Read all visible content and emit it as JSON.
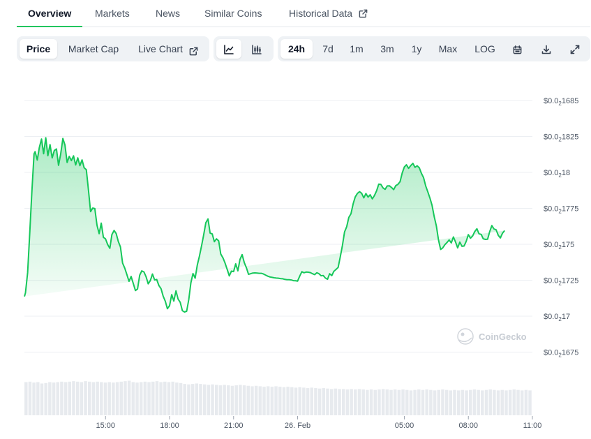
{
  "tabs": [
    {
      "label": "Overview"
    },
    {
      "label": "Markets"
    },
    {
      "label": "News"
    },
    {
      "label": "Similar Coins"
    },
    {
      "label": "Historical Data"
    }
  ],
  "toolbar": {
    "view_buttons": [
      {
        "label": "Price",
        "selected": true
      },
      {
        "label": "Market Cap",
        "selected": false
      },
      {
        "label": "Live Chart",
        "selected": false
      }
    ],
    "chart_type_buttons": [
      {
        "icon": "line-chart-icon",
        "selected": true
      },
      {
        "icon": "candlestick-chart-icon",
        "selected": false
      }
    ],
    "range_buttons": [
      {
        "label": "24h",
        "selected": true
      },
      {
        "label": "7d",
        "selected": false
      },
      {
        "label": "1m",
        "selected": false
      },
      {
        "label": "3m",
        "selected": false
      },
      {
        "label": "1y",
        "selected": false
      },
      {
        "label": "Max",
        "selected": false
      },
      {
        "label": "LOG",
        "selected": false
      }
    ],
    "action_icons": [
      "calendar-icon",
      "download-icon",
      "fullscreen-icon"
    ]
  },
  "watermark": "CoinGecko",
  "colors": {
    "line": "#16c75a",
    "accent": "#22c55e"
  },
  "chart_data": {
    "type": "area",
    "price_prefix": "$0.0",
    "price_subscript": "2",
    "y_ticks": [
      {
        "value": 0.001685,
        "digits": "1685"
      },
      {
        "value": 0.0018225,
        "digits": "1825"
      },
      {
        "value": 0.00218,
        "digits": "18"
      },
      {
        "value": 0.001775,
        "digits": "1775"
      },
      {
        "value": 0.00175,
        "digits": "175"
      },
      {
        "value": 0.001725,
        "digits": "1725"
      },
      {
        "value": 0.0017,
        "digits": "17"
      },
      {
        "value": 0.001675,
        "digits": "1675"
      }
    ],
    "y_tick_plain": [
      0.001685,
      0.0018225,
      0.0018,
      0.001775,
      0.00175,
      0.001725,
      0.0017,
      0.001675
    ],
    "ylim": [
      0.001675,
      0.001685
    ],
    "x_ticks": [
      "15:00",
      "18:00",
      "21:00",
      "26. Feb",
      "05:00",
      "08:00",
      "11:00"
    ],
    "x_tick_hours": [
      15,
      18,
      21,
      24,
      29,
      32,
      35
    ],
    "x_range_hours": [
      11.2,
      35.0
    ],
    "series": [
      {
        "x_hours": [
          11.2,
          11.25,
          11.35,
          11.45,
          11.55,
          11.65,
          11.7,
          11.8,
          11.9,
          12.0,
          12.1,
          12.2,
          12.3,
          12.4,
          12.5,
          12.6,
          12.7,
          12.8,
          12.9,
          13.0,
          13.1,
          13.2,
          13.3,
          13.4,
          13.5,
          13.6,
          13.7,
          13.8,
          13.9,
          14.0,
          14.1,
          14.2,
          14.3,
          14.4,
          14.5,
          14.6,
          14.7,
          14.8,
          14.9,
          15.0,
          15.1,
          15.2,
          15.3,
          15.4,
          15.5,
          15.6,
          15.7,
          15.8,
          15.9,
          16.0,
          16.1,
          16.2,
          16.3,
          16.4,
          16.5,
          16.6,
          16.7,
          16.8,
          16.9,
          17.0,
          17.1,
          17.2,
          17.3,
          17.4,
          17.5,
          17.6,
          17.7,
          17.8,
          17.9,
          18.0,
          18.1,
          18.2,
          18.3,
          18.4,
          18.5,
          18.6,
          18.7,
          18.8,
          18.9,
          19.0,
          19.1,
          19.2,
          19.3,
          19.4,
          19.5,
          19.6,
          19.7,
          19.8,
          19.9,
          20.0,
          20.1,
          20.2,
          20.3,
          20.4,
          20.5,
          20.6,
          20.7,
          20.8,
          20.9,
          21.0,
          21.1,
          21.2,
          21.3,
          21.4,
          21.5,
          21.6,
          21.7,
          21.8,
          21.9,
          22.0,
          22.1,
          22.2,
          22.3,
          22.4,
          22.5,
          22.6,
          22.7,
          22.8,
          22.9,
          23.0,
          23.1,
          23.2,
          23.3,
          23.4,
          23.5,
          23.6,
          23.7,
          23.8,
          23.9,
          24.0,
          24.1,
          24.2,
          24.3,
          24.4,
          24.5,
          24.6,
          24.7,
          24.8,
          24.9,
          25.0,
          25.1,
          25.2,
          25.3,
          25.4,
          25.5,
          25.6,
          25.7,
          25.8,
          25.9,
          26.0,
          26.1,
          26.2,
          26.3,
          26.4,
          26.5,
          26.6,
          26.7,
          26.8,
          26.9,
          27.0,
          27.1,
          27.2,
          27.3,
          27.4,
          27.5,
          27.6,
          27.7,
          27.8,
          27.9,
          28.0,
          28.1,
          28.2,
          28.3,
          28.4,
          28.5,
          28.6,
          28.7,
          28.8,
          28.9,
          29.0,
          29.1,
          29.2,
          29.3,
          29.4,
          29.5,
          29.6,
          29.7,
          29.8,
          29.9,
          30.0,
          30.1,
          30.2,
          30.3,
          30.4,
          30.5,
          30.6,
          30.7,
          30.8,
          30.9,
          31.0,
          31.1,
          31.2,
          31.3,
          31.4,
          31.5,
          31.6,
          31.7,
          31.8,
          31.9,
          32.0,
          32.1,
          32.2,
          32.3,
          32.4,
          32.5,
          32.6,
          32.7,
          32.8,
          32.9,
          33.0,
          33.1,
          33.2,
          33.3,
          33.4,
          33.5,
          33.6,
          33.7,
          33.8,
          33.9,
          34.0,
          34.1,
          34.2,
          34.3,
          34.4,
          34.5,
          34.6,
          34.7,
          34.8,
          34.9,
          35.0
        ],
        "prices": [
          0.0017137,
          0.0017162,
          0.0017303,
          0.0017575,
          0.0017868,
          0.0018129,
          0.0018144,
          0.0018086,
          0.0018174,
          0.0018232,
          0.001813,
          0.0018241,
          0.0018116,
          0.0018193,
          0.0018101,
          0.0018152,
          0.0018163,
          0.0018049,
          0.0018129,
          0.0018236,
          0.0018191,
          0.0018069,
          0.0018111,
          0.0018082,
          0.0018115,
          0.0018052,
          0.0018101,
          0.0018047,
          0.0018087,
          0.0018032,
          0.0018019,
          0.0017876,
          0.0017727,
          0.0017752,
          0.0017748,
          0.0017633,
          0.0017574,
          0.0017647,
          0.0017548,
          0.0017538,
          0.0017498,
          0.0017472,
          0.0017568,
          0.0017596,
          0.0017575,
          0.0017519,
          0.0017482,
          0.0017369,
          0.0017334,
          0.001729,
          0.0017242,
          0.0017276,
          0.0017227,
          0.0017178,
          0.0017189,
          0.0017285,
          0.0017315,
          0.0017308,
          0.0017274,
          0.0017225,
          0.0017248,
          0.0017293,
          0.0017252,
          0.0017255,
          0.0017213,
          0.0017191,
          0.001714,
          0.0017104,
          0.0017052,
          0.0017073,
          0.001715,
          0.0017105,
          0.0017176,
          0.0017119,
          0.0017096,
          0.0017038,
          0.0017029,
          0.0017034,
          0.0017114,
          0.0017233,
          0.0017296,
          0.0017264,
          0.0017357,
          0.0017417,
          0.001749,
          0.0017565,
          0.001765,
          0.0017676,
          0.0017578,
          0.0017572,
          0.0017518,
          0.0017538,
          0.0017524,
          0.0017432,
          0.0017406,
          0.001737,
          0.0017325,
          0.001728,
          0.0017313,
          0.001731,
          0.0017364,
          0.0017315,
          0.0017394,
          0.0017428,
          0.0017373,
          0.0017337,
          0.0017291,
          0.0017295,
          0.00173,
          0.0017301,
          0.00173,
          0.0017298,
          0.0017298,
          0.0017293,
          0.0017286,
          0.0017278,
          0.0017273,
          0.001727,
          0.0017267,
          0.0017265,
          0.0017264,
          0.0017261,
          0.001726,
          0.0017256,
          0.0017254,
          0.0017254,
          0.0017252,
          0.0017247,
          0.0017246,
          0.0017244,
          0.0017279,
          0.0017309,
          0.0017302,
          0.0017307,
          0.0017306,
          0.0017303,
          0.0017295,
          0.0017289,
          0.0017302,
          0.0017295,
          0.0017281,
          0.0017283,
          0.0017265,
          0.0017257,
          0.0017295,
          0.0017282,
          0.0017312,
          0.0017325,
          0.0017339,
          0.0017413,
          0.0017493,
          0.0017586,
          0.0017623,
          0.0017687,
          0.0017712,
          0.0017781,
          0.0017829,
          0.0017854,
          0.0017866,
          0.0017855,
          0.0017823,
          0.0017853,
          0.0017828,
          0.0017844,
          0.0017816,
          0.0017839,
          0.0017872,
          0.0017918,
          0.0017917,
          0.0017892,
          0.0017882,
          0.0017906,
          0.0017907,
          0.0017895,
          0.001788,
          0.0017908,
          0.0017917,
          0.0017936,
          0.0017995,
          0.0018038,
          0.0018053,
          0.0018028,
          0.0018047,
          0.0018063,
          0.0018035,
          0.0018046,
          0.0018032,
          0.0017994,
          0.0017964,
          0.0017906,
          0.0017865,
          0.0017821,
          0.0017771,
          0.0017692,
          0.0017627,
          0.0017531,
          0.0017464,
          0.0017475,
          0.0017497,
          0.0017512,
          0.001753,
          0.0017509,
          0.0017551,
          0.0017515,
          0.0017475,
          0.0017515,
          0.0017486,
          0.0017488,
          0.0017521,
          0.0017567,
          0.0017542,
          0.0017558,
          0.0017589,
          0.0017608,
          0.0017573,
          0.0017569,
          0.0017538,
          0.0017534,
          0.0017535,
          0.0017588,
          0.001763,
          0.0017607,
          0.0017601,
          0.0017562,
          0.0017544,
          0.0017577,
          0.0017595
        ]
      }
    ],
    "volume_relative": [
      0.72,
      0.73,
      0.71,
      0.72,
      0.69,
      0.7,
      0.72,
      0.71,
      0.72,
      0.73,
      0.72,
      0.73,
      0.74,
      0.73,
      0.72,
      0.74,
      0.73,
      0.72,
      0.73,
      0.72,
      0.71,
      0.72,
      0.71,
      0.72,
      0.73,
      0.74,
      0.75,
      0.72,
      0.71,
      0.72,
      0.73,
      0.72,
      0.73,
      0.74,
      0.72,
      0.73,
      0.72,
      0.73,
      0.71,
      0.7,
      0.68,
      0.67,
      0.68,
      0.69,
      0.68,
      0.67,
      0.66,
      0.67,
      0.66,
      0.65,
      0.66,
      0.65,
      0.64,
      0.65,
      0.66,
      0.65,
      0.64,
      0.63,
      0.64,
      0.63,
      0.62,
      0.63,
      0.62,
      0.63,
      0.62,
      0.61,
      0.62,
      0.61,
      0.6,
      0.61,
      0.6,
      0.59,
      0.6,
      0.59,
      0.58,
      0.59,
      0.58,
      0.57,
      0.58,
      0.57,
      0.57,
      0.56,
      0.57,
      0.56,
      0.57,
      0.56,
      0.55,
      0.56,
      0.55,
      0.56,
      0.57,
      0.56,
      0.55,
      0.56,
      0.55,
      0.56,
      0.55,
      0.54,
      0.55,
      0.56,
      0.55,
      0.56,
      0.55,
      0.54,
      0.55,
      0.56,
      0.55,
      0.54,
      0.55,
      0.54,
      0.55,
      0.54,
      0.55,
      0.56,
      0.55,
      0.54,
      0.55,
      0.56,
      0.55,
      0.54,
      0.55,
      0.54,
      0.55,
      0.56,
      0.55,
      0.54,
      0.55,
      0.54
    ]
  }
}
